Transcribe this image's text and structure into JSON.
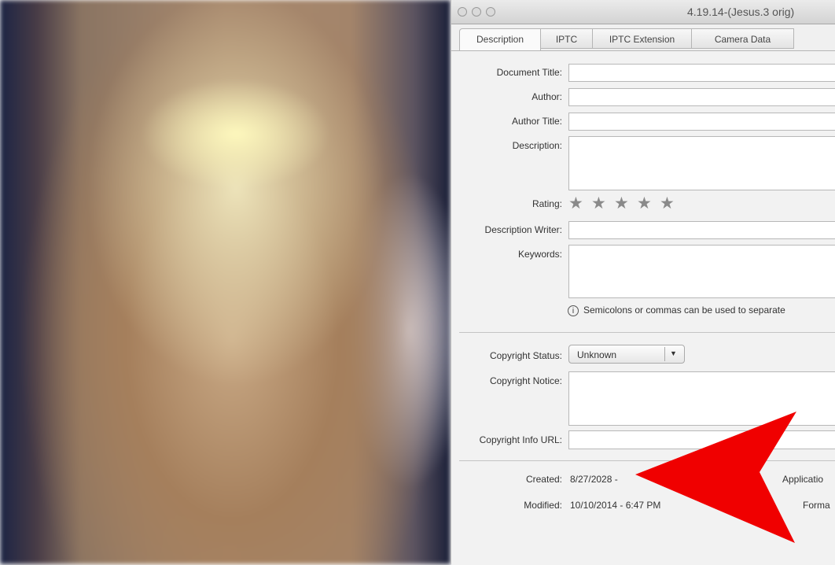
{
  "window": {
    "title": "4.19.14-(Jesus.3 orig)"
  },
  "tabs": [
    {
      "label": "Description",
      "active": true
    },
    {
      "label": "IPTC"
    },
    {
      "label": "IPTC Extension"
    },
    {
      "label": "Camera Data"
    }
  ],
  "fields": {
    "document_title": {
      "label": "Document Title:",
      "value": ""
    },
    "author": {
      "label": "Author:",
      "value": ""
    },
    "author_title": {
      "label": "Author Title:",
      "value": ""
    },
    "description": {
      "label": "Description:",
      "value": ""
    },
    "rating": {
      "label": "Rating:",
      "stars": 5,
      "filled": 0
    },
    "description_writer": {
      "label": "Description Writer:",
      "value": ""
    },
    "keywords": {
      "label": "Keywords:",
      "value": ""
    },
    "keywords_hint": "Semicolons or commas can be used to separate",
    "copyright_status": {
      "label": "Copyright Status:",
      "value": "Unknown"
    },
    "copyright_notice": {
      "label": "Copyright Notice:",
      "value": ""
    },
    "copyright_url": {
      "label": "Copyright Info URL:",
      "value": ""
    }
  },
  "meta": {
    "created_label": "Created:",
    "created_value": "8/27/2028 -",
    "modified_label": "Modified:",
    "modified_value": "10/10/2014 - 6:47 PM",
    "application_label": "Applicatio",
    "format_label": "Forma"
  },
  "icons": {
    "info": "info-icon",
    "dropdown": "chevron-down-icon",
    "star": "star-icon",
    "annotation": "red-arrow-annotation"
  },
  "colors": {
    "annotation_arrow": "#f00000",
    "panel_bg": "#f0f0f0",
    "star": "#8a8a8a"
  }
}
